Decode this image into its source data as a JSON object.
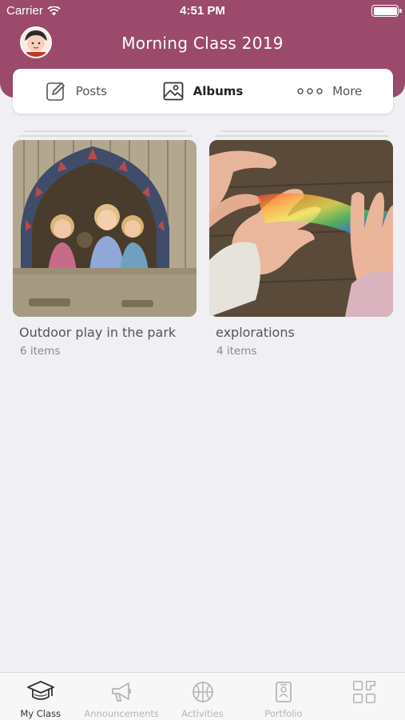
{
  "status": {
    "carrier": "Carrier",
    "time": "4:51 PM"
  },
  "header": {
    "title": "Morning Class 2019",
    "background": "#9b4a6c"
  },
  "tabs": [
    {
      "label": "Posts",
      "icon": "edit-icon",
      "active": false
    },
    {
      "label": "Albums",
      "icon": "image-icon",
      "active": true
    },
    {
      "label": "More",
      "icon": "dots-icon",
      "active": false
    }
  ],
  "albums": [
    {
      "name": "Outdoor play in the park",
      "count": "6 items",
      "image": "children-in-playhouse-window"
    },
    {
      "name": "explorations",
      "count": "4 items",
      "image": "hands-in-rainbow-light"
    }
  ],
  "tabbar": [
    {
      "label": "My Class",
      "icon": "graduation-cap-icon",
      "active": true
    },
    {
      "label": "Announcements",
      "icon": "megaphone-icon",
      "active": false
    },
    {
      "label": "Activities",
      "icon": "ball-icon",
      "active": false
    },
    {
      "label": "Portfolio",
      "icon": "portfolio-icon",
      "active": false
    },
    {
      "label": "",
      "icon": "grid-icon",
      "active": false
    }
  ]
}
